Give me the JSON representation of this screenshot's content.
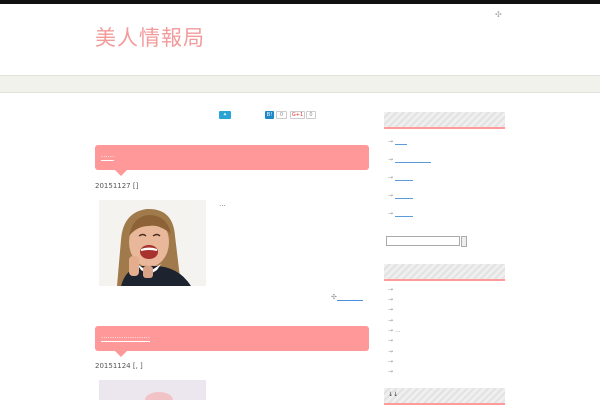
{
  "site": {
    "title": "美人情報局",
    "rss_icon": "rss-plus-icon"
  },
  "share": {
    "twitter_label": "",
    "hatena_label": "B!",
    "hatena_count": "0",
    "gplus_label": "G+1",
    "gplus_count": "0"
  },
  "posts": [
    {
      "title": "......",
      "meta": "20151127 []",
      "excerpt": "...",
      "more": ""
    },
    {
      "title": "......................",
      "meta": "20151124 [, ]"
    }
  ],
  "sidebar": {
    "widget1_heading": "",
    "links": [
      "",
      "",
      "",
      "",
      ""
    ],
    "widget2_heading": "",
    "archive_extra": "...",
    "widget3_heading": "↓↓"
  },
  "colors": {
    "accent": "#ff9999",
    "link": "#4a8fd8",
    "logo": "#f29b9b"
  }
}
